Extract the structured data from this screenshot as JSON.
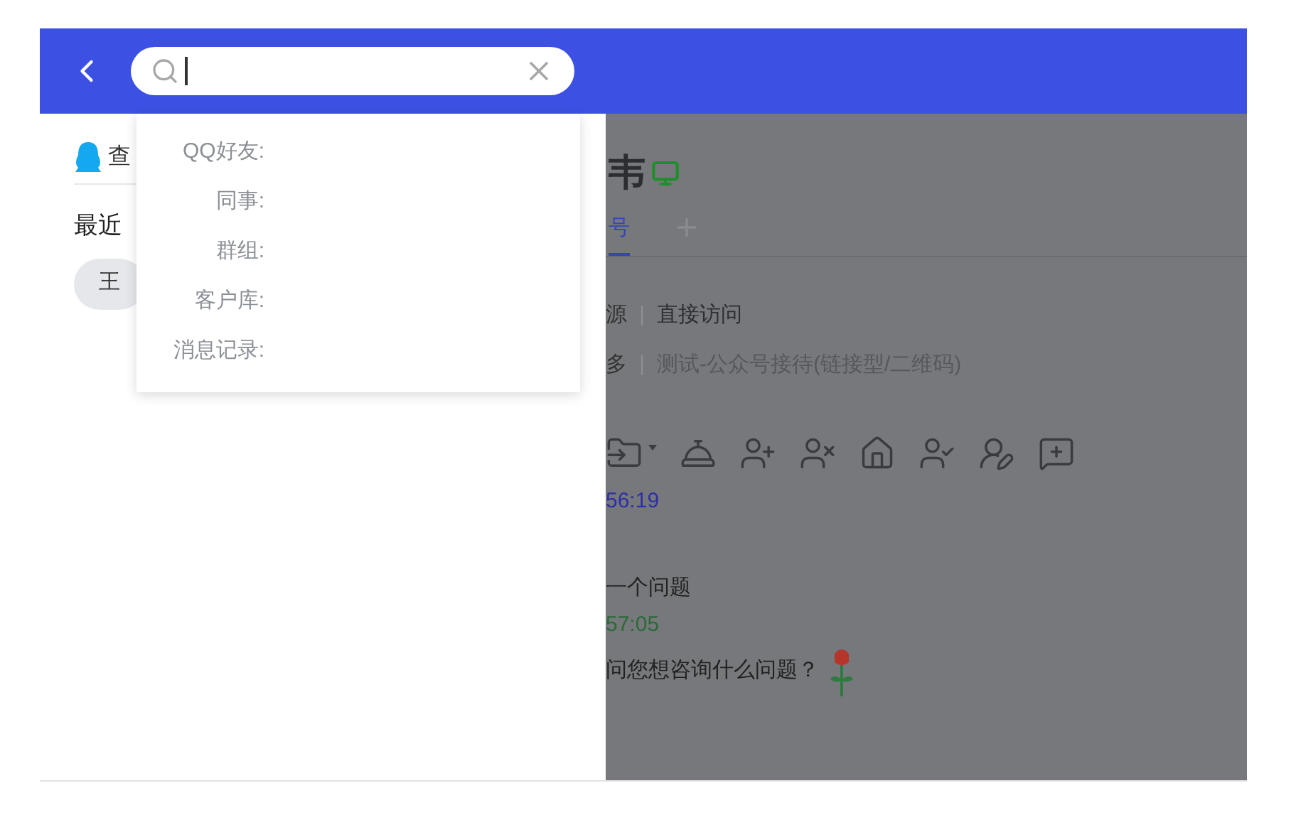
{
  "search_scopes": [
    {
      "label": "QQ好友:"
    },
    {
      "label": "同事:"
    },
    {
      "label": "群组:"
    },
    {
      "label": "客户库:"
    },
    {
      "label": "消息记录:"
    }
  ],
  "sidebar": {
    "header_text": "查",
    "section_title": "最近",
    "chips": [
      "王"
    ]
  },
  "visitor": {
    "name": "韦",
    "online": true,
    "tabs": [
      {
        "label": "号",
        "selected": true
      }
    ],
    "info_rows": [
      {
        "label": "源",
        "value": "直接访问"
      },
      {
        "label": "多",
        "value": "测试-公众号接待(链接型/二维码)"
      }
    ],
    "messages": [
      {
        "kind": "visitor",
        "time": "56:19",
        "text": "一个问题"
      },
      {
        "kind": "agent",
        "time": "57:05",
        "text": "问您想咨询什么问题？",
        "rose": true
      }
    ]
  }
}
